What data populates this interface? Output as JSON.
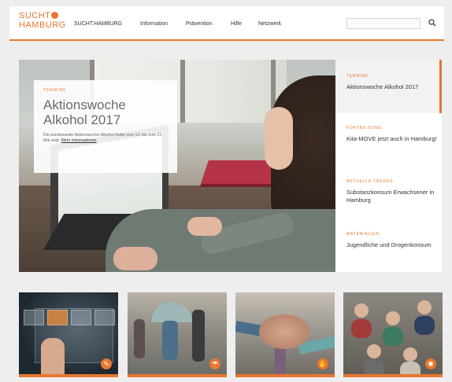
{
  "logo": {
    "line1": "SUCHT",
    "line2": "HAMBURG"
  },
  "nav": {
    "items": [
      {
        "label": "SUCHT.HAMBURG"
      },
      {
        "label": "Information"
      },
      {
        "label": "Prävention"
      },
      {
        "label": "Hilfe"
      },
      {
        "label": "Netzwerk"
      }
    ]
  },
  "search": {
    "icon": "search-icon"
  },
  "hero": {
    "kicker": "TERMINE",
    "title": "Aktionswoche Alkohol 2017",
    "text": "Die bundesweite Aktionswoche Alkohol findet vom 13. bis zum 21. Mai statt.",
    "link": "Mehr Informationen"
  },
  "side": {
    "items": [
      {
        "kicker": "TERMINE",
        "title": "Aktionswoche Alkohol 2017"
      },
      {
        "kicker": "FORTBILDUNG",
        "title": "Kita-MOVE jetzt auch in Hamburg!"
      },
      {
        "kicker": "AKTUELLE TRENDS",
        "title": "Substanzkonsum Erwachsener in Hamburg"
      },
      {
        "kicker": "MATERIALIEN",
        "title": "Jugendliche und Drogenkonsum"
      }
    ]
  },
  "tiles": [
    {
      "icon": "pen-icon",
      "glyph": "✎"
    },
    {
      "icon": "umbrella-icon",
      "glyph": "☂"
    },
    {
      "icon": "hands-icon",
      "glyph": "✋"
    },
    {
      "icon": "network-icon",
      "glyph": "✺"
    }
  ],
  "colors": {
    "accent": "#e8772e"
  }
}
